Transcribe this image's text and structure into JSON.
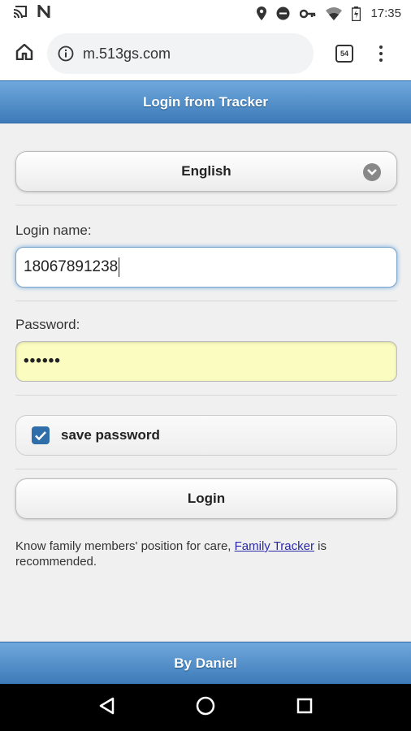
{
  "status_bar": {
    "time": "17:35",
    "left_icons": [
      "cast-icon",
      "n-notification-icon"
    ],
    "right_icons": [
      "location-icon",
      "dnd-icon",
      "key-icon",
      "wifi-icon",
      "battery-icon"
    ]
  },
  "browser": {
    "url": "m.513gs.com",
    "tab_count": "54"
  },
  "page": {
    "header_title": "Login from Tracker",
    "language_selected": "English",
    "login_label": "Login name:",
    "login_value": "18067891238",
    "password_label": "Password:",
    "password_mask": "••••••",
    "save_password_label": "save password",
    "save_password_checked": true,
    "login_button": "Login",
    "info_prefix": "Know family members' position for care, ",
    "info_link": "Family Tracker",
    "info_suffix": " is recommended.",
    "footer_text": "By Daniel"
  },
  "colors": {
    "header_blue": "#4a8bc9",
    "password_bg": "#fafcc0",
    "checkbox": "#2f6ea8",
    "link": "#2a2aa8"
  }
}
